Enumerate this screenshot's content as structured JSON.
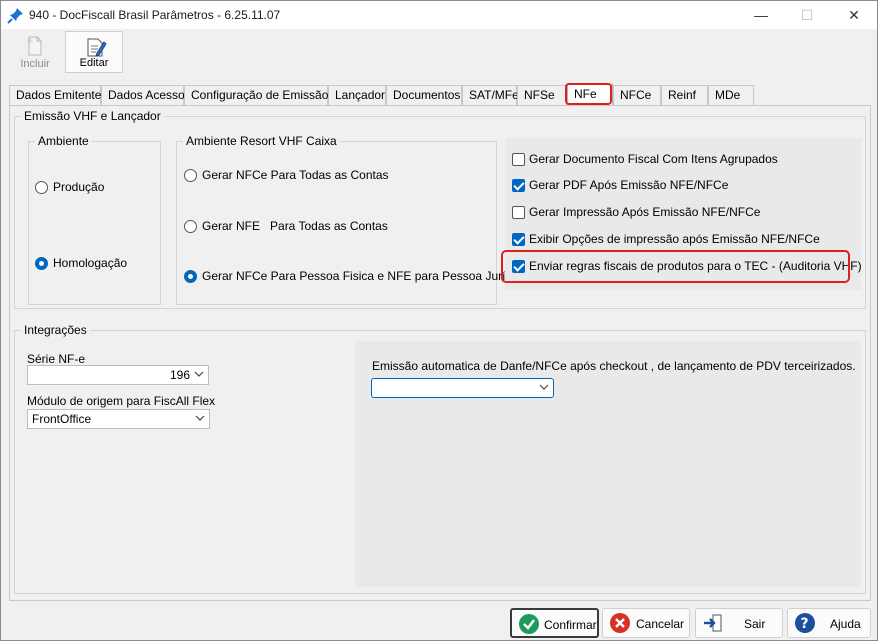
{
  "window": {
    "title": "940 - DocFiscall Brasil Parâmetros - 6.25.11.07",
    "minimize_glyph": "—",
    "maximize_glyph": "☐",
    "close_glyph": "✕"
  },
  "toolbar": {
    "incluir_label": "Incluir",
    "editar_label": "Editar"
  },
  "tabs": [
    {
      "label": "Dados Emitente"
    },
    {
      "label": "Dados Acesso"
    },
    {
      "label": "Configuração de Emissão"
    },
    {
      "label": "Lançador"
    },
    {
      "label": "Documentos"
    },
    {
      "label": "SAT/MFe"
    },
    {
      "label": "NFSe"
    },
    {
      "label": "NFe"
    },
    {
      "label": "NFCe"
    },
    {
      "label": "Reinf"
    },
    {
      "label": "MDe"
    }
  ],
  "active_tab": "NFe",
  "emissao": {
    "legend": "Emissão VHF e Lançador",
    "ambiente": {
      "legend": "Ambiente",
      "options": [
        {
          "label": "Produção",
          "checked": false
        },
        {
          "label": "Homologação",
          "checked": true
        }
      ]
    },
    "resort": {
      "legend": "Ambiente Resort VHF Caixa",
      "options": [
        {
          "label": "Gerar NFCe Para Todas as Contas",
          "checked": false
        },
        {
          "label": "Gerar NFE   Para Todas as Contas",
          "checked": false
        },
        {
          "label": "Gerar NFCe Para Pessoa Fisica e NFE para Pessoa Jurídica",
          "checked": true
        }
      ]
    },
    "checks": [
      {
        "label": "Gerar Documento Fiscal Com Itens Agrupados",
        "checked": false
      },
      {
        "label": "Gerar PDF Após Emissão NFE/NFCe",
        "checked": true
      },
      {
        "label": "Gerar Impressão Após Emissão NFE/NFCe",
        "checked": false
      },
      {
        "label": "Exibir Opções de impressão após Emissão NFE/NFCe",
        "checked": true
      },
      {
        "label": "Enviar regras fiscais de produtos para o TEC - (Auditoria VHF)",
        "checked": true
      }
    ]
  },
  "integracoes": {
    "legend": "Integrações",
    "serie_label": "Série NF-e",
    "serie_value": "196",
    "modulo_label": "Módulo de origem para FiscAll Flex",
    "modulo_value": "FrontOffice",
    "emissao_auto_label": "Emissão automatica de Danfe/NFCe após checkout , de lançamento de PDV terceirizados.",
    "emissao_auto_value": ""
  },
  "buttons": {
    "confirmar": "Confirmar",
    "cancelar": "Cancelar",
    "sair": "Sair",
    "ajuda": "Ajuda"
  },
  "colors": {
    "accent": "#0067c0",
    "highlight": "#e02020",
    "confirm_icon": "#1e9a5a",
    "cancel_icon": "#d93025",
    "help_icon": "#1e4f9c"
  }
}
